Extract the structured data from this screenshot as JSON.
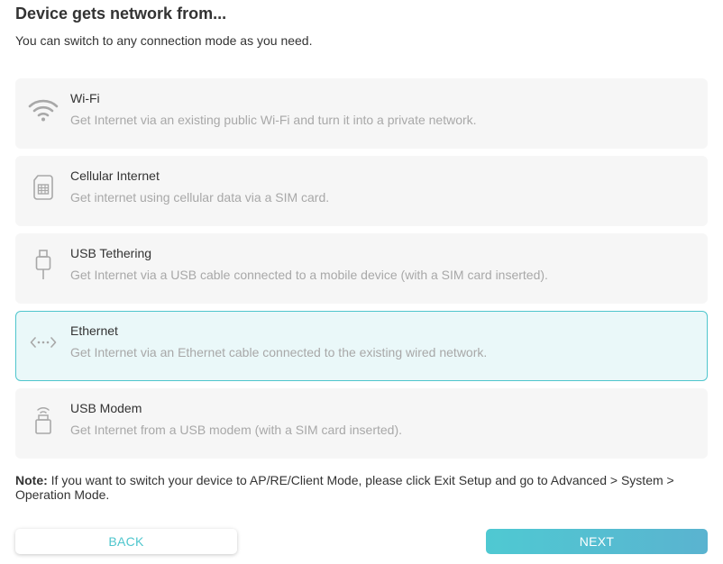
{
  "heading": "Device gets network from...",
  "subheading": "You can switch to any connection mode as you need.",
  "options": [
    {
      "title": "Wi-Fi",
      "description": "Get Internet via an existing public Wi-Fi and turn it into a private network.",
      "icon": "wifi-icon",
      "selected": false
    },
    {
      "title": "Cellular Internet",
      "description": "Get internet using cellular data via a SIM card.",
      "icon": "sim-card-icon",
      "selected": false
    },
    {
      "title": "USB Tethering",
      "description": "Get Internet via a USB cable connected to a mobile device (with a SIM card inserted).",
      "icon": "usb-cable-icon",
      "selected": false
    },
    {
      "title": "Ethernet",
      "description": "Get Internet via an Ethernet cable connected to the existing wired network.",
      "icon": "ethernet-icon",
      "selected": true
    },
    {
      "title": "USB Modem",
      "description": "Get Internet from a USB modem (with a SIM card inserted).",
      "icon": "usb-modem-icon",
      "selected": false
    }
  ],
  "note": {
    "label": "Note:",
    "text": " If you want to switch your device to AP/RE/Client Mode, please click Exit Setup and go to Advanced > System > Operation Mode."
  },
  "buttons": {
    "back": "BACK",
    "next": "NEXT"
  },
  "colors": {
    "accent": "#4fc6cd",
    "selected_background": "#eaf8f9",
    "option_background": "#f6f6f6",
    "icon": "#a8a8a8"
  }
}
